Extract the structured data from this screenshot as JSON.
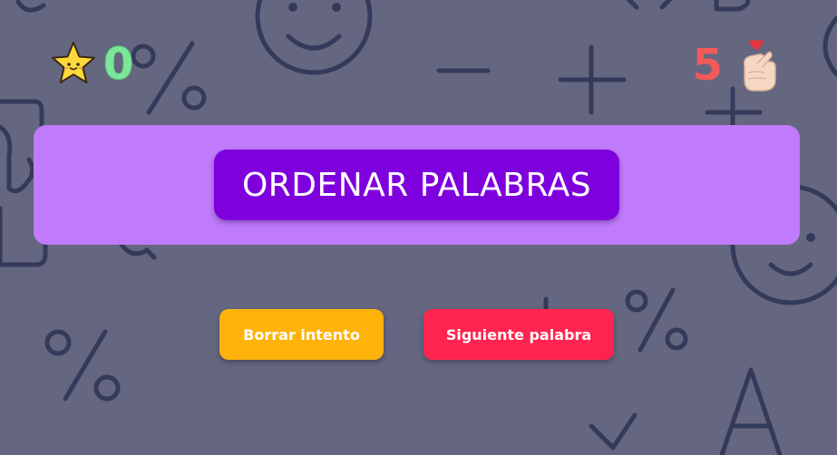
{
  "score": {
    "icon": "star-face-icon",
    "value": "0",
    "color": "#7ce79a"
  },
  "lives": {
    "value": "5",
    "icon": "finger-heart-hand-icon",
    "color": "#f25a5a"
  },
  "game": {
    "title": "ORDENAR PALABRAS",
    "panel_color": "#bf7bfb",
    "title_color": "#7e00dc"
  },
  "actions": {
    "clear_label": "Borrar intento",
    "clear_color": "#ffb20a",
    "next_label": "Siguiente palabra",
    "next_color": "#ff2450"
  },
  "background": {
    "color": "#64677f",
    "doodle_color": "#343a5a"
  }
}
